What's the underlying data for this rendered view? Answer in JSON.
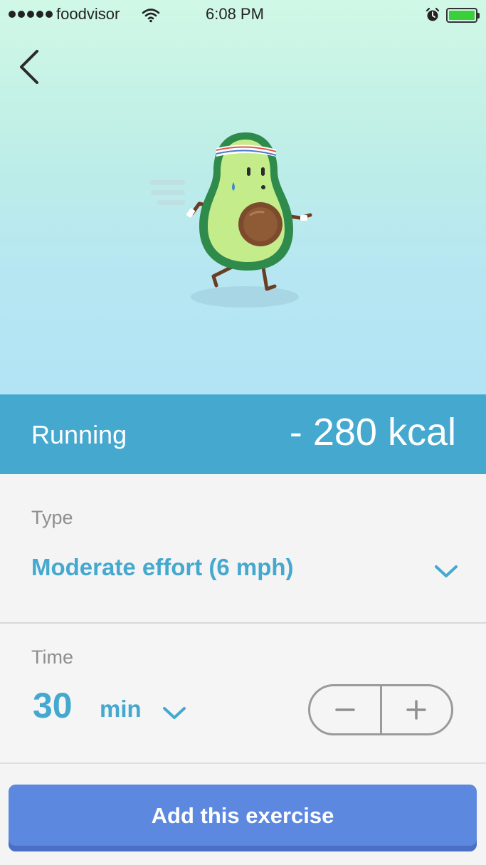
{
  "status_bar": {
    "carrier": "foodvisor",
    "time": "6:08 PM",
    "icons": [
      "signal-dots-icon",
      "wifi-icon",
      "alarm-icon",
      "battery-icon"
    ],
    "battery_level": 1.0,
    "battery_color": "#3ccf3c"
  },
  "nav": {
    "back_icon": "chevron-left-icon"
  },
  "hero": {
    "illustration": "running-avocado-mascot"
  },
  "exercise": {
    "name": "Running",
    "calories": "- 280 kcal",
    "band_color": "#44a8cf"
  },
  "type": {
    "label": "Type",
    "value": "Moderate effort (6 mph)",
    "icon": "chevron-down-icon"
  },
  "time": {
    "label": "Time",
    "value": "30",
    "unit": "min",
    "unit_icon": "chevron-down-icon",
    "stepper": {
      "decrement_icon": "minus-icon",
      "increment_icon": "plus-icon"
    }
  },
  "actions": {
    "add_label": "Add this exercise",
    "button_color": "#5d88e0"
  }
}
